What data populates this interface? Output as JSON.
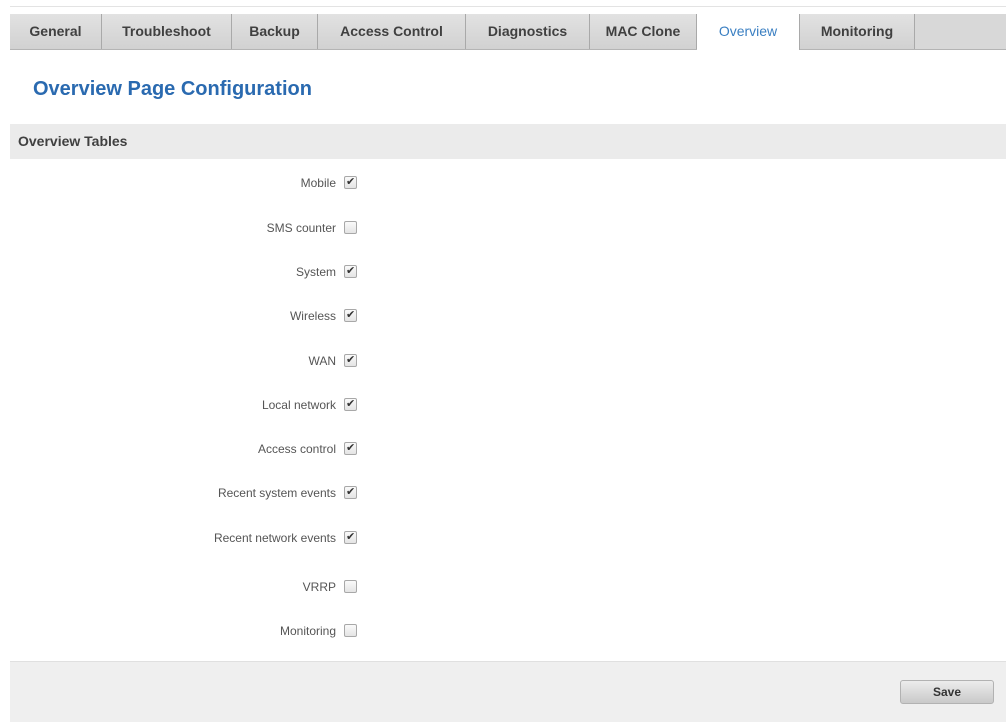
{
  "tabs": [
    {
      "label": "General",
      "active": false
    },
    {
      "label": "Troubleshoot",
      "active": false
    },
    {
      "label": "Backup",
      "active": false
    },
    {
      "label": "Access Control",
      "active": false
    },
    {
      "label": "Diagnostics",
      "active": false
    },
    {
      "label": "MAC Clone",
      "active": false
    },
    {
      "label": "Overview",
      "active": true
    },
    {
      "label": "Monitoring",
      "active": false
    }
  ],
  "page": {
    "title": "Overview Page Configuration",
    "section_title": "Overview Tables"
  },
  "options": [
    {
      "label": "Mobile",
      "checked": true
    },
    {
      "label": "SMS counter",
      "checked": false
    },
    {
      "label": "System",
      "checked": true
    },
    {
      "label": "Wireless",
      "checked": true
    },
    {
      "label": "WAN",
      "checked": true
    },
    {
      "label": "Local network",
      "checked": true
    },
    {
      "label": "Access control",
      "checked": true
    },
    {
      "label": "Recent system events",
      "checked": true
    },
    {
      "label": "Recent network events",
      "checked": true
    },
    {
      "label": "VRRP",
      "checked": false
    },
    {
      "label": "Monitoring",
      "checked": false
    }
  ],
  "footer": {
    "save_label": "Save"
  },
  "colors": {
    "accent": "#2a6ab0",
    "active_tab_text": "#3a7fc2",
    "tab_bar": "#d8d8d8",
    "section_bg": "#ebebeb",
    "footer_bg": "#efefef"
  },
  "icons": {
    "checked": "checkmark-icon"
  }
}
